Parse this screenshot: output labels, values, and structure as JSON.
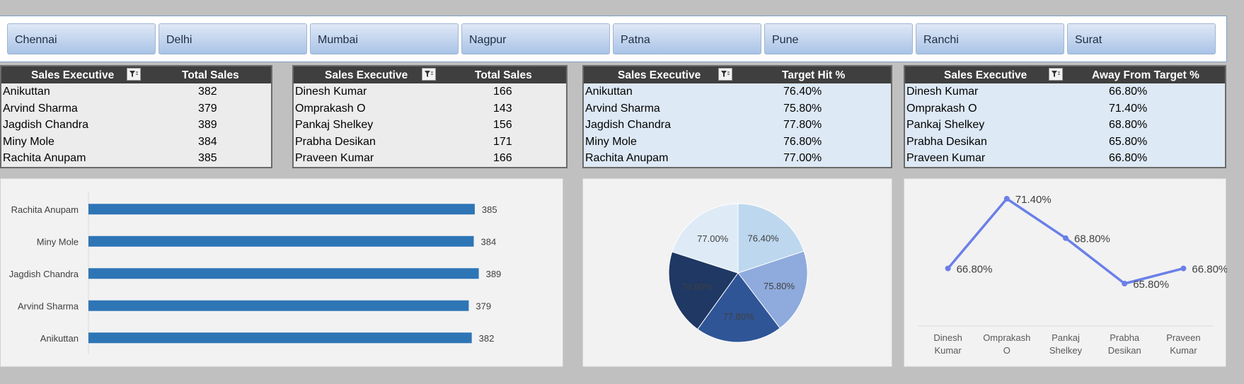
{
  "slicer": {
    "items": [
      "Chennai",
      "Delhi",
      "Mumbai",
      "Nagpur",
      "Patna",
      "Pune",
      "Ranchi",
      "Surat"
    ]
  },
  "tables": [
    {
      "headers": [
        "Sales Executive",
        "Total Sales"
      ],
      "rows": [
        [
          "Anikuttan",
          "382"
        ],
        [
          "Arvind Sharma",
          "379"
        ],
        [
          "Jagdish Chandra",
          "389"
        ],
        [
          "Miny Mole",
          "384"
        ],
        [
          "Rachita Anupam",
          "385"
        ]
      ]
    },
    {
      "headers": [
        "Sales Executive",
        "Total Sales"
      ],
      "rows": [
        [
          "Dinesh Kumar",
          "166"
        ],
        [
          "Omprakash O",
          "143"
        ],
        [
          "Pankaj Shelkey",
          "156"
        ],
        [
          "Prabha Desikan",
          "171"
        ],
        [
          "Praveen Kumar",
          "166"
        ]
      ]
    },
    {
      "headers": [
        "Sales Executive",
        "Target Hit %"
      ],
      "rows": [
        [
          "Anikuttan",
          "76.40%"
        ],
        [
          "Arvind Sharma",
          "75.80%"
        ],
        [
          "Jagdish Chandra",
          "77.80%"
        ],
        [
          "Miny Mole",
          "76.80%"
        ],
        [
          "Rachita Anupam",
          "77.00%"
        ]
      ]
    },
    {
      "headers": [
        "Sales Executive",
        "Away From Target %"
      ],
      "rows": [
        [
          "Dinesh Kumar",
          "66.80%"
        ],
        [
          "Omprakash O",
          "71.40%"
        ],
        [
          "Pankaj Shelkey",
          "68.80%"
        ],
        [
          "Prabha Desikan",
          "65.80%"
        ],
        [
          "Praveen Kumar",
          "66.80%"
        ]
      ]
    }
  ],
  "chart_data": [
    {
      "type": "bar",
      "orientation": "horizontal",
      "categories": [
        "Rachita Anupam",
        "Miny Mole",
        "Jagdish Chandra",
        "Arvind Sharma",
        "Anikuttan"
      ],
      "values": [
        385,
        384,
        389,
        379,
        382
      ],
      "data_labels": [
        "385",
        "384",
        "389",
        "379",
        "382"
      ],
      "color": "#2e75b6",
      "grid": false
    },
    {
      "type": "pie",
      "labels": [
        "76.40%",
        "75.80%",
        "77.80%",
        "76.80%",
        "77.00%"
      ],
      "values": [
        76.4,
        75.8,
        77.8,
        76.8,
        77.0
      ],
      "colors": [
        "#bdd7ee",
        "#8faadc",
        "#2f5597",
        "#1f3864",
        "#deebf7"
      ]
    },
    {
      "type": "line",
      "categories": [
        [
          "Dinesh",
          "Kumar"
        ],
        [
          "Omprakash",
          "O"
        ],
        [
          "Pankaj",
          "Shelkey"
        ],
        [
          "Prabha",
          "Desikan"
        ],
        [
          "Praveen",
          "Kumar"
        ]
      ],
      "values": [
        66.8,
        71.4,
        68.8,
        65.8,
        66.8
      ],
      "data_labels": [
        "66.80%",
        "71.40%",
        "68.80%",
        "65.80%",
        "66.80%"
      ],
      "color": "#6a7fe8",
      "grid": false
    }
  ]
}
